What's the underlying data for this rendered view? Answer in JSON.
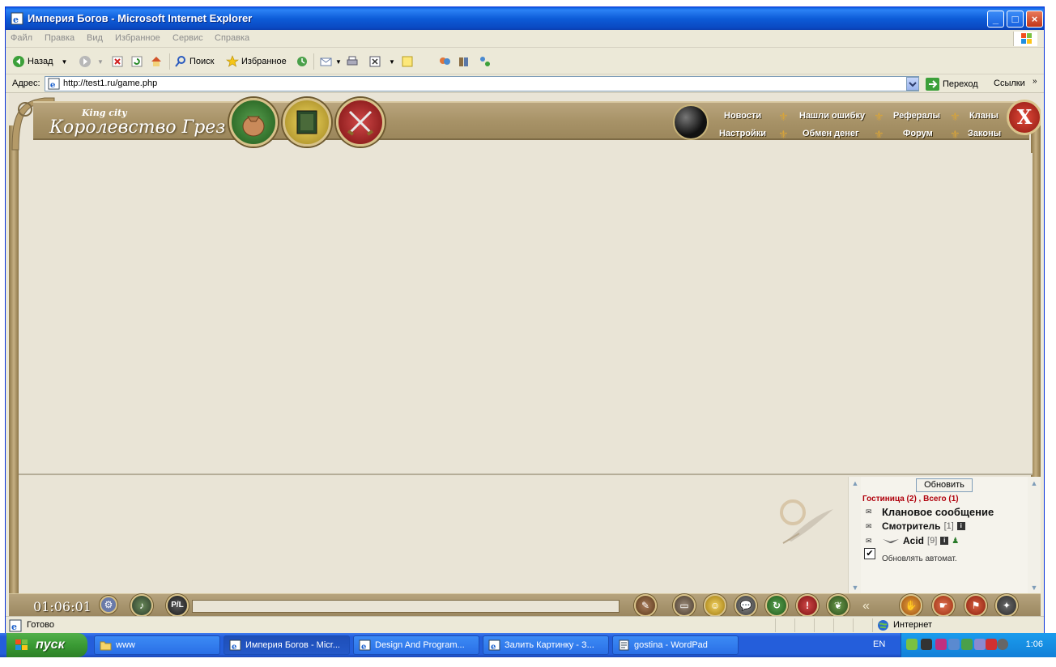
{
  "window": {
    "title": "Империя Богов - Microsoft Internet Explorer",
    "buttons": {
      "minimize": "_",
      "maximize": "□",
      "close": "×"
    }
  },
  "menu": [
    "Файл",
    "Правка",
    "Вид",
    "Избранное",
    "Сервис",
    "Справка"
  ],
  "toolbar": {
    "back_label": "Назад",
    "search_label": "Поиск",
    "favorites_label": "Избранное"
  },
  "address": {
    "label": "Адрес:",
    "url": "http://test1.ru/game.php",
    "go_label": "Переход",
    "links_label": "Ссылки"
  },
  "game": {
    "logo_sub": "King city",
    "logo": "Королевство Грез",
    "nav_top": [
      "Новости",
      "Нашли ошибку",
      "Рефералы",
      "Кланы"
    ],
    "nav_bottom": [
      "Настройки",
      "Обмен денег",
      "Форум",
      "Законы"
    ],
    "exit_label": "X",
    "clock": "01:06:01",
    "pl_label": "P/L",
    "users": {
      "refresh_label": "Обновить",
      "room": "Гостиница (2) , Всего (1)",
      "rows": [
        {
          "name": "Клановое сообщение",
          "level": ""
        },
        {
          "name": "Смотритель",
          "level": "[1]"
        },
        {
          "name": "Acid",
          "level": "[9]"
        }
      ],
      "auto_refresh_label": "Обновлять автомат.",
      "auto_refresh_checked": "✔"
    }
  },
  "status": {
    "text": "Готово",
    "zone": "Интернет"
  },
  "taskbar": {
    "start_label": "пуск",
    "tasks": [
      "www",
      "Империя Богов - Micr...",
      "Design And Program...",
      "Залить Картинку - З...",
      "gostina - WordPad"
    ],
    "lang": "EN",
    "time": "1:06"
  }
}
